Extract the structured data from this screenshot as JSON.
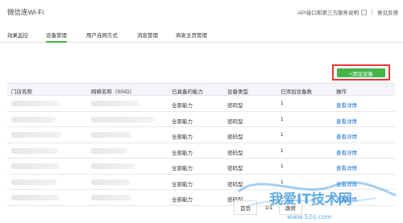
{
  "header": {
    "title": "微信连Wi-Fi",
    "api_link": "API接口和第三方服务说明",
    "feedback": "意见反馈"
  },
  "tabs": [
    "效果监控",
    "设备管理",
    "用户连网方式",
    "消息管理",
    "商家主页管理"
  ],
  "active_tab": 1,
  "add_button": "+添加设备",
  "table": {
    "columns": [
      "门店名称",
      "网络名称（SSID）",
      "已具备的能力",
      "设备类型",
      "已添加设备数",
      "操作"
    ],
    "rows": [
      {
        "capability": "全部能力",
        "type": "密码型",
        "count": "1",
        "action": "查看详情"
      },
      {
        "capability": "全部能力",
        "type": "密码型",
        "count": "1",
        "action": "查看详情"
      },
      {
        "capability": "全部能力",
        "type": "密码型",
        "count": "1",
        "action": "查看详情"
      },
      {
        "capability": "全部能力",
        "type": "密码型",
        "count": "1",
        "action": "查看详情"
      },
      {
        "capability": "全部能力",
        "type": "密码型",
        "count": "1",
        "action": "查看详情"
      },
      {
        "capability": "全部能力",
        "type": "密码型",
        "count": "1",
        "action": "查看详情"
      },
      {
        "capability": "全部能力",
        "type": "密码型",
        "count": "1",
        "action": "查看详情"
      }
    ]
  },
  "pager": {
    "first": "首页",
    "page": "1/1",
    "next": "跳转"
  },
  "watermark": {
    "text": "我爱IT技术网",
    "url": "www.52ij.com"
  },
  "colors": {
    "accent": "#44b549",
    "highlight": "#e53935",
    "link": "#1e6fd9"
  }
}
